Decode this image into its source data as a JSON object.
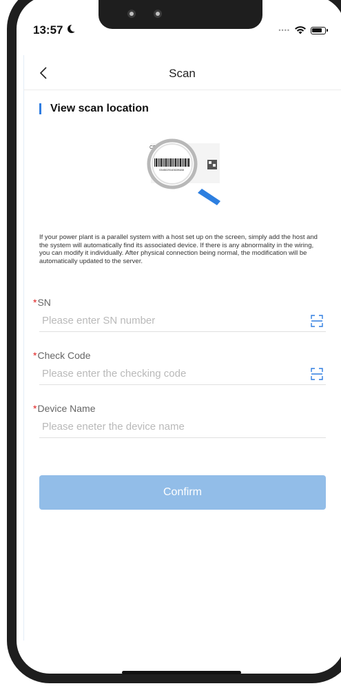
{
  "status_bar": {
    "time": "13:57"
  },
  "nav": {
    "title": "Scan",
    "back_icon": "chevron-left-icon"
  },
  "section": {
    "title": "View scan location"
  },
  "description": "If your power plant is a parallel system with a host set up on the screen, simply add the host and the system will automatically find its associated device. If there is any abnormality in the wiring, you can modify it individually. After physical connection being normal, the modification will be automatically updated to the server.",
  "illustration": {
    "barcode_text": "0345029163639488"
  },
  "fields": {
    "sn": {
      "required_mark": "*",
      "label": "SN",
      "placeholder": "Please enter SN number",
      "icon": "scan-icon"
    },
    "check_code": {
      "required_mark": "*",
      "label": "Check Code",
      "placeholder": "Please enter the checking code",
      "icon": "scan-icon"
    },
    "device_name": {
      "required_mark": "*",
      "label": "Device Name",
      "placeholder": "Please eneter the device name"
    }
  },
  "confirm": {
    "label": "Confirm"
  },
  "colors": {
    "accent": "#2f7de1",
    "button": "#92bde8",
    "required": "#e02020"
  }
}
